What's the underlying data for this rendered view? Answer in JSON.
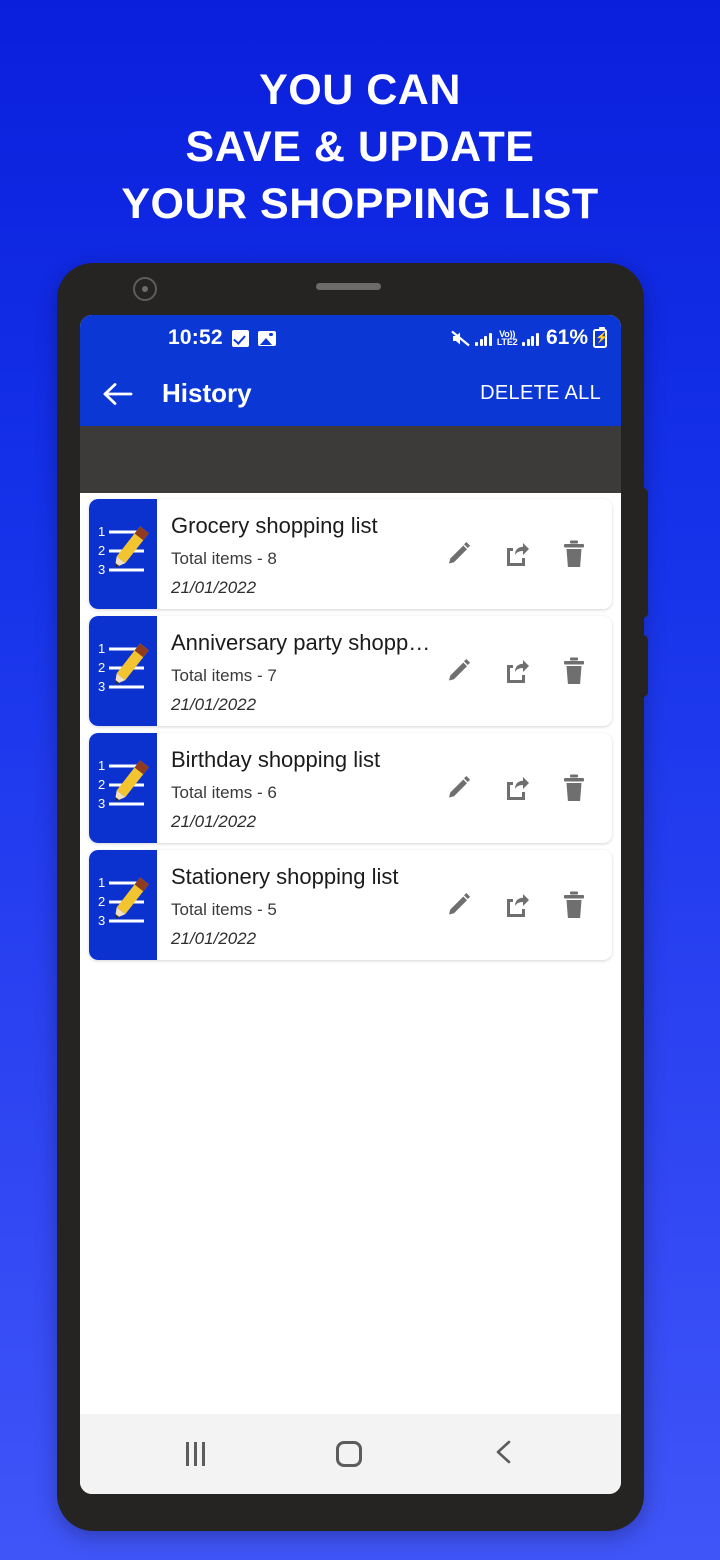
{
  "promo": {
    "headline_lines": [
      "YOU CAN",
      "SAVE & UPDATE",
      "YOUR SHOPPING LIST"
    ],
    "background_top_color": "#0a1fdc",
    "background_bottom_color": "#4055f8"
  },
  "status_bar": {
    "time": "10:52",
    "check_icon": "check-square-icon",
    "photo_icon": "image-icon",
    "mute_icon": "mute-icon",
    "network_label": "Vo))",
    "network_sub_label": "LTE2",
    "battery_percent": "61%",
    "battery_icon": "battery-charging-icon",
    "background_color": "#0b38d4"
  },
  "app_bar": {
    "back_icon": "back-arrow-icon",
    "title": "History",
    "action_label": "DELETE ALL",
    "background_color": "#0b38d4",
    "text_color": "#ffffff"
  },
  "ad_band": {
    "background_color": "#3d3b39"
  },
  "list": {
    "item_icon": "numbered-list-pencil-icon",
    "icon_background_color": "#0b32cf",
    "action_icons": [
      "edit-pencil-icon",
      "share-icon",
      "trash-icon"
    ],
    "items": [
      {
        "title": "Grocery shopping list",
        "subtitle": "Total items - 8",
        "date": "21/01/2022"
      },
      {
        "title": "Anniversary party shopp…",
        "subtitle": "Total items - 7",
        "date": "21/01/2022"
      },
      {
        "title": "Birthday shopping list",
        "subtitle": "Total items - 6",
        "date": "21/01/2022"
      },
      {
        "title": "Stationery shopping list",
        "subtitle": "Total items - 5",
        "date": "21/01/2022"
      }
    ]
  },
  "nav_bar": {
    "recents_icon": "recents-icon",
    "home_icon": "home-icon",
    "back_icon": "nav-back-icon",
    "background_color": "#f3f3f3"
  }
}
